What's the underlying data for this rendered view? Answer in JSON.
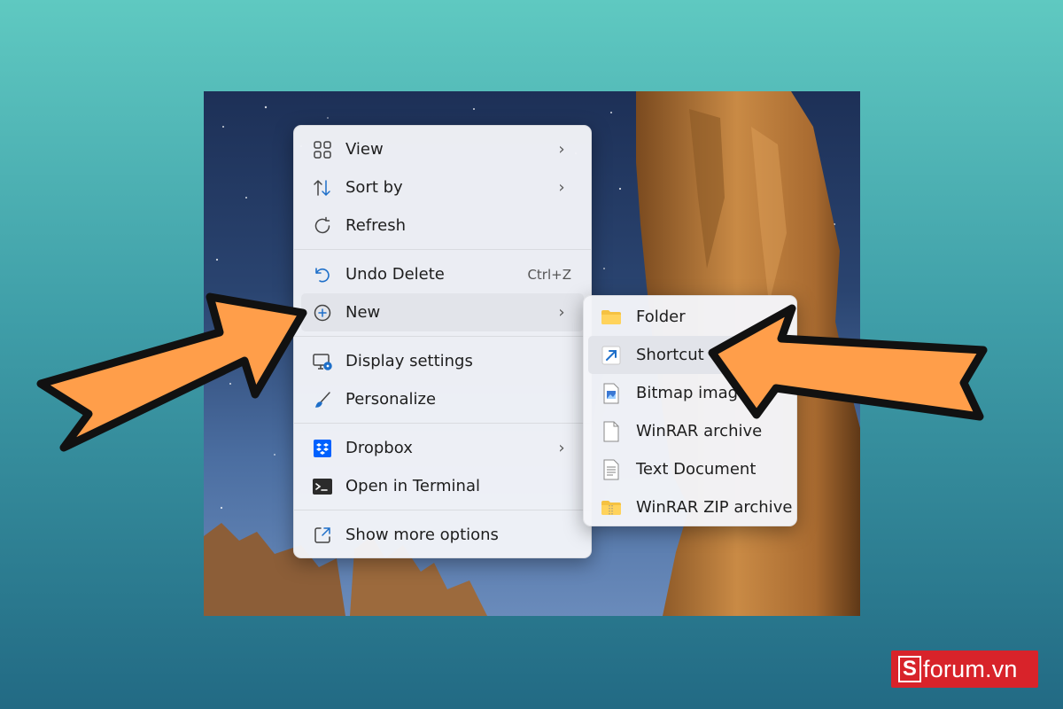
{
  "context_menu": {
    "items": [
      {
        "label": "View",
        "icon": "view-grid-icon",
        "has_submenu": true
      },
      {
        "label": "Sort by",
        "icon": "sort-icon",
        "has_submenu": true
      },
      {
        "label": "Refresh",
        "icon": "refresh-icon",
        "has_submenu": false
      },
      {
        "label": "Undo Delete",
        "icon": "undo-icon",
        "shortcut": "Ctrl+Z"
      },
      {
        "label": "New",
        "icon": "add-circle-icon",
        "has_submenu": true,
        "highlighted": true
      },
      {
        "label": "Display settings",
        "icon": "display-settings-icon"
      },
      {
        "label": "Personalize",
        "icon": "brush-icon"
      },
      {
        "label": "Dropbox",
        "icon": "dropbox-icon",
        "has_submenu": true
      },
      {
        "label": "Open in Terminal",
        "icon": "terminal-icon"
      },
      {
        "label": "Show more options",
        "icon": "show-more-icon"
      }
    ]
  },
  "new_submenu": {
    "items": [
      {
        "label": "Folder",
        "icon": "folder-icon"
      },
      {
        "label": "Shortcut",
        "icon": "shortcut-icon",
        "highlighted": true
      },
      {
        "label": "Bitmap image",
        "icon": "bitmap-image-icon"
      },
      {
        "label": "WinRAR archive",
        "icon": "file-icon"
      },
      {
        "label": "Text Document",
        "icon": "text-document-icon"
      },
      {
        "label": "WinRAR ZIP archive",
        "icon": "zip-archive-icon"
      }
    ]
  },
  "watermark": {
    "logo_letter": "S",
    "text": "forum.vn"
  },
  "colors": {
    "arrow": "#ff9e4a",
    "accent": "#0067c0",
    "brand": "#d8232a"
  }
}
